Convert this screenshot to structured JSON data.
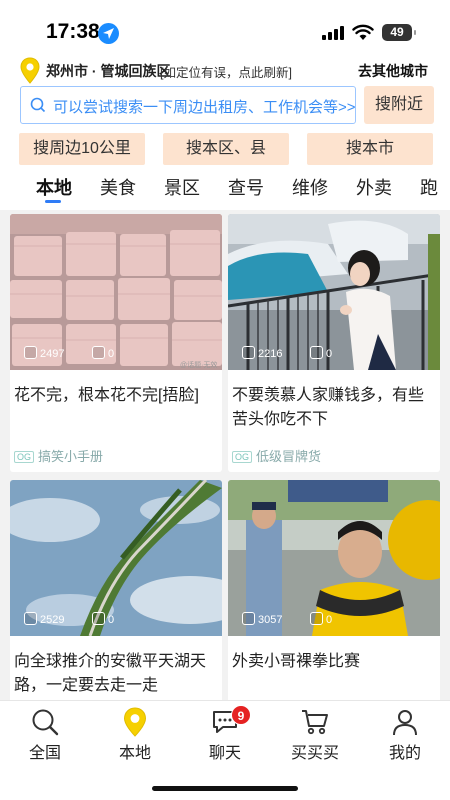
{
  "status_bar": {
    "time": "17:38",
    "battery": "49"
  },
  "location": {
    "city": "郑州市 · 管城回族区",
    "hint": "[如定位有误，点此刷新]",
    "other_city": "去其他城市"
  },
  "search": {
    "placeholder": "可以尝试搜索一下周边出租房、工作机会等>>",
    "nearby_button": "搜附近"
  },
  "quick_buttons": [
    "搜周边10公里",
    "搜本区、县",
    "搜本市"
  ],
  "tabs": [
    "本地",
    "美食",
    "景区",
    "查号",
    "维修",
    "外卖",
    "跑"
  ],
  "active_tab": "本地",
  "feed": [
    {
      "views": "2497",
      "comments": "0",
      "title": "花不完，根本花不完[捂脸]",
      "source": "搞笑小手册",
      "source_tag": "OG",
      "watermark": "@话题·无效"
    },
    {
      "views": "2216",
      "comments": "0",
      "title": "不要羡慕人家赚钱多，有些苦头你吃不下",
      "source": "低级冒牌货",
      "source_tag": "OG"
    },
    {
      "views": "2529",
      "comments": "0",
      "title": "向全球推介的安徽平天湖天路，一定要去走一走"
    },
    {
      "views": "3057",
      "comments": "0",
      "title": "外卖小哥裸拳比赛"
    }
  ],
  "bottom_nav": {
    "items": [
      {
        "label": "全国",
        "icon": "search-globe-icon"
      },
      {
        "label": "本地",
        "icon": "location-pin-icon"
      },
      {
        "label": "聊天",
        "icon": "chat-bubble-icon",
        "badge": "9"
      },
      {
        "label": "买买买",
        "icon": "shopping-cart-icon"
      },
      {
        "label": "我的",
        "icon": "user-profile-icon"
      }
    ]
  },
  "colors": {
    "accent_blue": "#2f7cf6",
    "button_peach": "#fde3cf",
    "pin_yellow": "#f6d000",
    "badge_red": "#e52222"
  }
}
